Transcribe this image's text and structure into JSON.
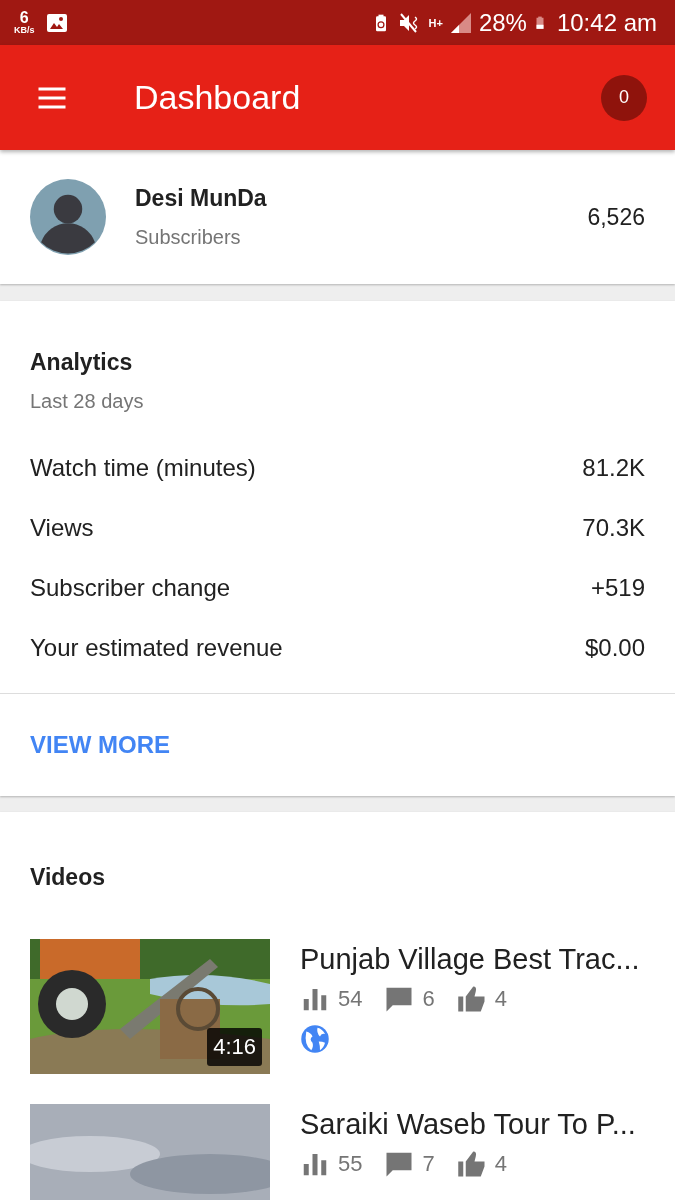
{
  "status_bar": {
    "speed": "6",
    "speed_unit": "KB/s",
    "network": "H+",
    "battery": "28%",
    "time": "10:42 am"
  },
  "toolbar": {
    "title": "Dashboard",
    "notifications": "0"
  },
  "channel": {
    "name": "Desi MunDa",
    "caption": "Subscribers",
    "subscribers": "6,526"
  },
  "analytics": {
    "title": "Analytics",
    "period": "Last 28 days",
    "metrics": [
      {
        "label": "Watch time (minutes)",
        "value": "81.2K"
      },
      {
        "label": "Views",
        "value": "70.3K"
      },
      {
        "label": "Subscriber change",
        "value": "+519"
      },
      {
        "label": "Your estimated revenue",
        "value": "$0.00"
      }
    ],
    "action": "VIEW MORE"
  },
  "videos": {
    "title": "Videos",
    "items": [
      {
        "title": "Punjab Village Best Trac...",
        "duration": "4:16",
        "views": "54",
        "comments": "6",
        "likes": "4",
        "public": true
      },
      {
        "title": "Saraiki Waseb Tour To P...",
        "views": "55",
        "comments": "7",
        "likes": "4"
      }
    ]
  }
}
